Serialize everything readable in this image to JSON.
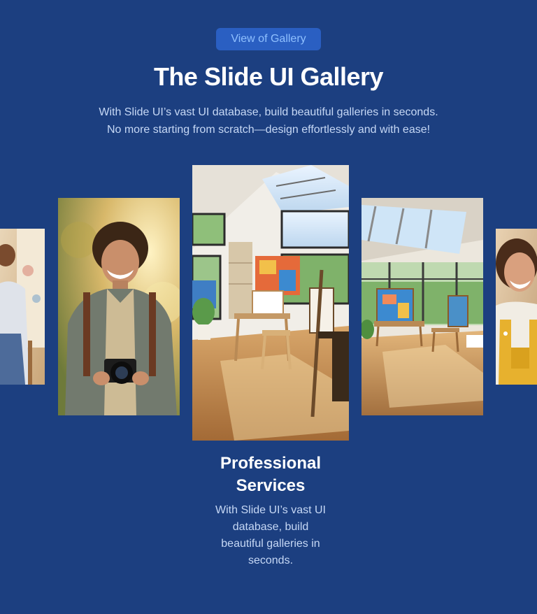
{
  "header": {
    "badge_label": "View of Gallery",
    "title": "The Slide UI Gallery",
    "subtitle_lines": [
      "With Slide UI’s vast UI database, build beautiful galleries in seconds.",
      "No more starting from scratch—design effortlessly and with ease!"
    ]
  },
  "gallery": {
    "items": [
      {
        "image": "painter-woman-photo"
      },
      {
        "image": "photographer-man-photo"
      },
      {
        "image": "art-studio-easels-photo"
      },
      {
        "image": "art-studio-skylight-photo"
      },
      {
        "image": "smiling-woman-overalls-photo"
      }
    ],
    "active_caption": {
      "title_lines": [
        "Professional",
        "Services"
      ],
      "text_lines": [
        "With Slide UI’s vast UI",
        "database, build",
        "beautiful galleries in",
        "seconds."
      ]
    }
  },
  "colors": {
    "background": "#1c3f80",
    "badge_bg": "#2a5fc2",
    "badge_text": "#8fc0ff",
    "body_text": "#c6d8f5"
  }
}
